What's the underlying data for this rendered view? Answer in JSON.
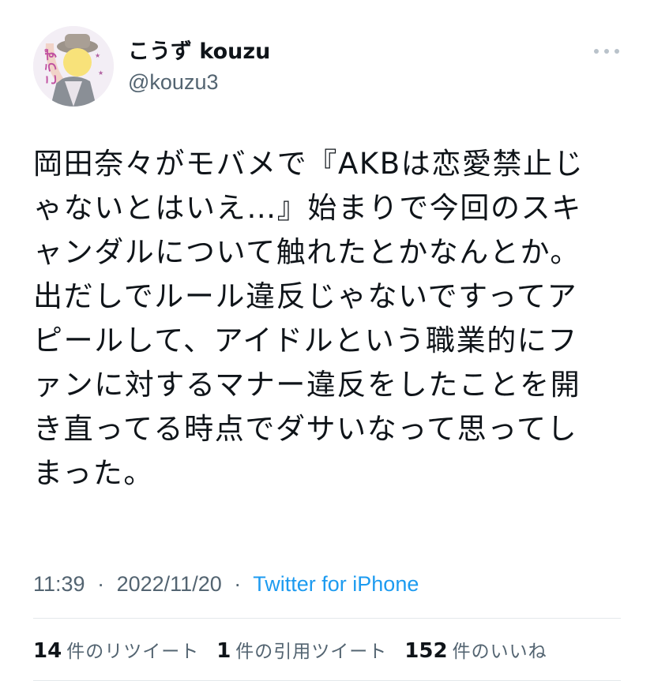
{
  "author": {
    "display_name": "こうず kouzu",
    "handle": "@kouzu3",
    "avatar_icon": "profile-photo-icon",
    "avatar_text": "こうず"
  },
  "tweet": {
    "lines": [
      "岡田奈々がモバメで『AKBは恋愛禁止じ",
      "ゃないとはいえ…』始まりで今回のスキ",
      "ャンダルについて触れたとかなんとか。",
      "出だしでルール違反じゃないですってア",
      "ピールして、アイドルという職業的にフ",
      "ァンに対するマナー違反をしたことを開",
      "き直ってる時点でダサいなって思ってし",
      "まった。"
    ]
  },
  "meta": {
    "time": "11:39",
    "date": "2022/11/20",
    "separator": "·",
    "source": "Twitter for iPhone"
  },
  "stats": {
    "retweets_count": "14",
    "retweets_label": "件のリツイート",
    "quotes_count": "1",
    "quotes_label": "件の引用ツイート",
    "likes_count": "152",
    "likes_label": "件のいいね"
  },
  "colors": {
    "text": "#0f1419",
    "secondary": "#536471",
    "link": "#1d9bf0",
    "divider": "#e4e8eb"
  }
}
